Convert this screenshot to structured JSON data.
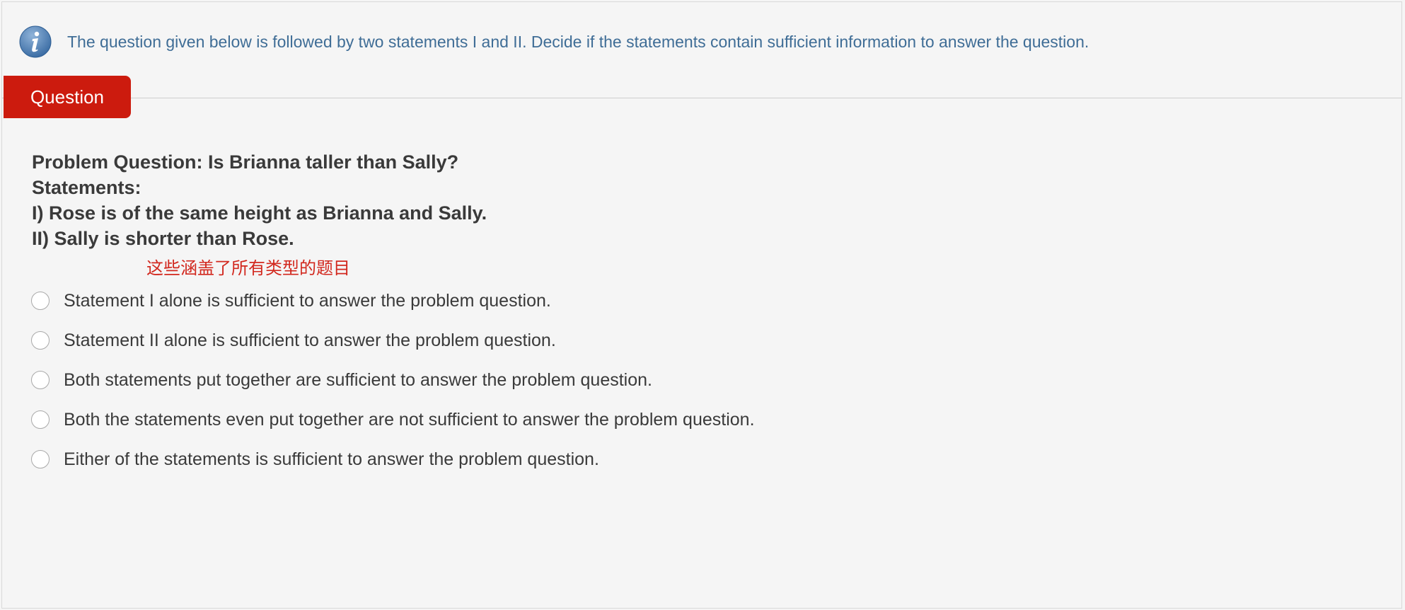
{
  "instruction": {
    "icon": "info-icon",
    "text": "The question given below is followed by two statements I and II. Decide if the statements contain sufficient information to answer the question."
  },
  "tab": {
    "label": "Question",
    "color": "#cc1b0e"
  },
  "problem": {
    "question": "Problem Question: Is Brianna taller than Sally?",
    "statements_heading": "Statements:",
    "statement_1": "I) Rose is of the same height as Brianna and Sally.",
    "statement_2": "II) Sally is shorter than Rose."
  },
  "annotation": "这些涵盖了所有类型的题目",
  "options": [
    "Statement I alone is sufficient to answer the problem question.",
    "Statement II alone is sufficient to answer the problem question.",
    "Both statements put together are sufficient to answer the problem question.",
    "Both the statements even put together are not sufficient to answer the problem question.",
    "Either of the statements is sufficient to answer the problem question."
  ],
  "colors": {
    "instruction_text": "#3f6d96",
    "annotation": "#d2281e",
    "body_text": "#3a3a3a"
  }
}
